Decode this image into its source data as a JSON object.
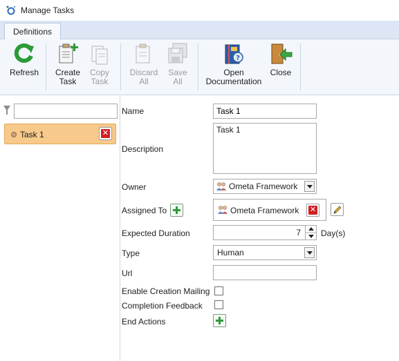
{
  "window": {
    "title": "Manage Tasks"
  },
  "tabs": [
    {
      "label": "Definitions"
    }
  ],
  "ribbon": {
    "refresh": "Refresh",
    "create_task": [
      "Create",
      "Task"
    ],
    "copy_task": [
      "Copy",
      "Task"
    ],
    "discard_all": [
      "Discard",
      "All"
    ],
    "save_all": [
      "Save",
      "All"
    ],
    "open_documentation": [
      "Open",
      "Documentation"
    ],
    "close": "Close"
  },
  "left": {
    "filter_value": "",
    "tasks": [
      {
        "label": "Task 1"
      }
    ]
  },
  "form": {
    "name_label": "Name",
    "name_value": "Task 1",
    "description_label": "Description",
    "description_value": "Task 1",
    "owner_label": "Owner",
    "owner_value": "Ometa Framework",
    "assigned_label": "Assigned To",
    "assigned_value": "Ometa Framework",
    "duration_label": "Expected Duration",
    "duration_value": "7",
    "duration_unit": "Day(s)",
    "type_label": "Type",
    "type_value": "Human",
    "url_label": "Url",
    "url_value": "",
    "mailing_label": "Enable Creation Mailing",
    "mailing_checked": false,
    "feedback_label": "Completion Feedback",
    "feedback_checked": false,
    "end_actions_label": "End Actions"
  },
  "colors": {
    "tab_strip": "#dce6f4",
    "ribbon": "#f3f7fc",
    "selected_item": "#f7c98a",
    "delete_red": "#d21f25",
    "add_green": "#2f9a3a"
  }
}
